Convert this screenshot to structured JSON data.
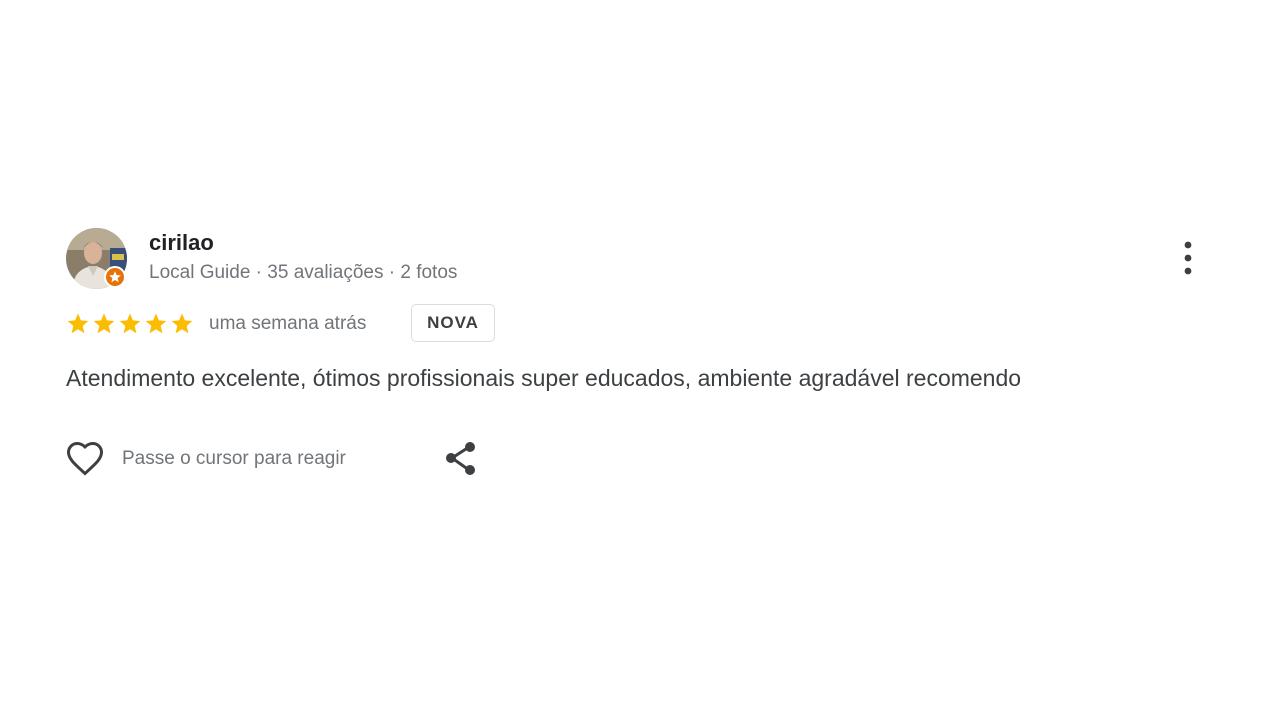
{
  "review": {
    "author": {
      "name": "cirilao",
      "meta": "Local Guide · 35 avaliações · 2 fotos",
      "avatar_icon": "user-avatar-photo",
      "badge_icon": "local-guide-star-badge",
      "badge_color": "#e8710a"
    },
    "rating": {
      "stars": 5,
      "max_stars": 5,
      "star_color": "#fbbc04",
      "date": "uma semana atrás",
      "new_label": "NOVA"
    },
    "text": "Atendimento excelente, ótimos profissionais super educados, ambiente agradável recomendo",
    "actions": {
      "react_label": "Passe o cursor para reagir",
      "react_icon": "heart-icon",
      "share_icon": "share-icon",
      "more_icon": "more-vert-icon"
    }
  }
}
